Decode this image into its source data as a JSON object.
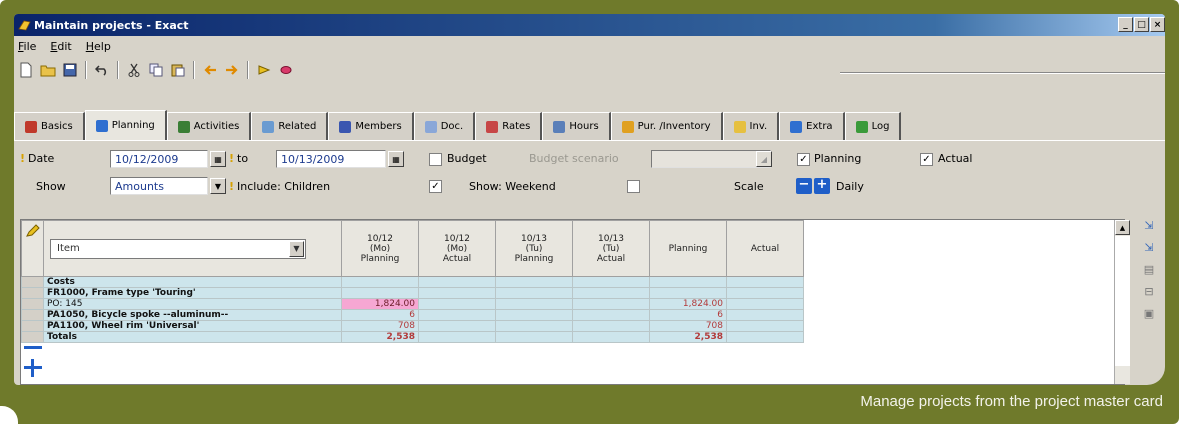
{
  "window": {
    "title": "Maintain projects - Exact",
    "controls": [
      "_",
      "□",
      "×"
    ]
  },
  "menu": [
    "File",
    "Edit",
    "Help"
  ],
  "toolbar_icons": [
    "new-doc-icon",
    "open-folder-icon",
    "save-icon",
    "undo-icon",
    "cut-icon",
    "copy-icon",
    "paste-icon",
    "back-icon",
    "forward-icon",
    "find-icon",
    "link-icon"
  ],
  "tabs": [
    {
      "label": "Basics",
      "color": "#c0392b"
    },
    {
      "label": "Planning",
      "color": "#2f6fd0",
      "active": true
    },
    {
      "label": "Activities",
      "color": "#3a7e35"
    },
    {
      "label": "Related",
      "color": "#6a9bd1"
    },
    {
      "label": "Members",
      "color": "#3a56b0"
    },
    {
      "label": "Doc.",
      "color": "#8aa7d8"
    },
    {
      "label": "Rates",
      "color": "#c74646"
    },
    {
      "label": "Hours",
      "color": "#5a7fb9"
    },
    {
      "label": "Pur. /Inventory",
      "color": "#e0a020"
    },
    {
      "label": "Inv.",
      "color": "#e6c040"
    },
    {
      "label": "Extra",
      "color": "#2f6fd0"
    },
    {
      "label": "Log",
      "color": "#3a9a3a"
    }
  ],
  "form": {
    "date_label": "Date",
    "date_value": "10/12/2009",
    "to_label": "to",
    "to_value": "10/13/2009",
    "budget_label": "Budget",
    "budget_checked": "",
    "budget_scenario_label": "Budget scenario",
    "planning_label": "Planning",
    "planning_checked": "✓",
    "actual_label": "Actual",
    "actual_checked": "✓",
    "show_label": "Show",
    "show_value": "Amounts",
    "include_label": "Include: Children",
    "include_checked": "✓",
    "weekend_label": "Show: Weekend",
    "weekend_checked": "",
    "scale_label": "Scale",
    "scale_value": "Daily"
  },
  "grid": {
    "item_selector": "Item",
    "columns": [
      {
        "l1": "10/12",
        "l2": "(Mo)",
        "l3": "Planning"
      },
      {
        "l1": "10/12",
        "l2": "(Mo)",
        "l3": "Actual"
      },
      {
        "l1": "10/13",
        "l2": "(Tu)",
        "l3": "Planning"
      },
      {
        "l1": "10/13",
        "l2": "(Tu)",
        "l3": "Actual"
      },
      {
        "l1": "",
        "l2": "Planning",
        "l3": ""
      },
      {
        "l1": "",
        "l2": "Actual",
        "l3": ""
      }
    ],
    "rows": [
      {
        "desc": "Costs",
        "bold": true,
        "c1": "",
        "c5": ""
      },
      {
        "desc": "FR1000, Frame type 'Touring'",
        "bold": true,
        "c1": "",
        "c5": ""
      },
      {
        "desc": "PO: 145",
        "bold": false,
        "c1": "1,824.00",
        "c5": "1,824.00",
        "pink": true
      },
      {
        "desc": "PA1050, Bicycle spoke --aluminum--",
        "bold": true,
        "c1": "6",
        "c5": "6"
      },
      {
        "desc": "PA1100, Wheel rim 'Universal'",
        "bold": true,
        "c1": "708",
        "c5": "708"
      },
      {
        "desc": "Totals",
        "bold": true,
        "c1": "2,538",
        "c5": "2,538",
        "total": true
      }
    ]
  },
  "side_tools": [
    "add-line-icon",
    "insert-line-icon",
    "copy-grid-icon",
    "export-icon",
    "print-icon"
  ],
  "caption": "Manage projects from the project master card"
}
